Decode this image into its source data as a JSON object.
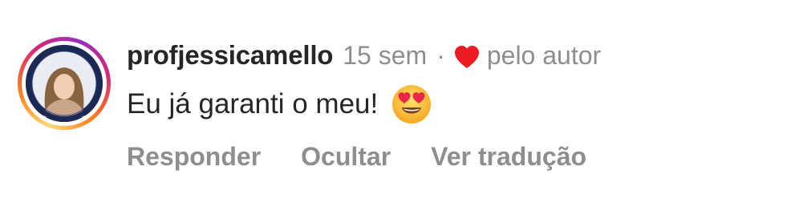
{
  "comment": {
    "username": "profjessicamello",
    "time_ago": "15 sem",
    "separator": "·",
    "liked_by_author_label": "pelo autor",
    "text": "Eu já garanti o meu!",
    "emoji": "smiling-face-with-heart-eyes-icon",
    "avatar": {
      "icon": "profile-photo-avatar",
      "ring_colors": [
        "#feda75",
        "#fa7e1e",
        "#d62976",
        "#962fbf"
      ]
    },
    "heart_color": "#ed1c24"
  },
  "actions": {
    "reply_label": "Responder",
    "hide_label": "Ocultar",
    "translate_label": "Ver tradução"
  }
}
